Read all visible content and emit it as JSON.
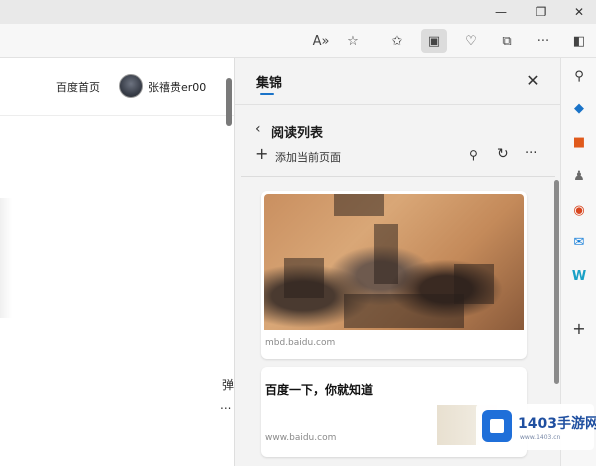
{
  "window": {
    "minimize_glyph": "—",
    "maximize_glyph": "❐",
    "close_glyph": "✕"
  },
  "toolbar": {
    "icons": [
      "read-aloud-icon",
      "favorite-star-icon",
      "favorites-icon",
      "collections-icon",
      "browser-essentials-icon",
      "screenshot-icon",
      "more-icon",
      "sidebar-toggle-icon"
    ],
    "read_aloud_glyph": "A»",
    "favorite_glyph": "☆",
    "favorites_glyph": "✩",
    "collections_glyph": "▣",
    "essentials_glyph": "♡",
    "screenshot_glyph": "⧉",
    "more_glyph": "···",
    "sidebar_glyph": "◧"
  },
  "page": {
    "nav_home": "百度首页",
    "username": "张禧贵er00",
    "snippet1": "弹",
    "snippet2": "..."
  },
  "collections": {
    "title": "集锦",
    "close_glyph": "✕",
    "back_glyph": "‹",
    "list_title": "阅读列表",
    "add_glyph": "+",
    "add_label": "添加当前页面",
    "search_glyph": "⚲",
    "refresh_glyph": "↻",
    "more_glyph": "···",
    "items": [
      {
        "domain": "mbd.baidu.com"
      },
      {
        "title": "百度一下，你就知道",
        "domain": "www.baidu.com"
      }
    ]
  },
  "sidebar": {
    "search_glyph": "⚲",
    "tag_glyph": "◆",
    "toolbox_glyph": "■",
    "games_glyph": "♟",
    "office_glyph": "◉",
    "outlook_glyph": "✉",
    "send_glyph": "W",
    "add_glyph": "+",
    "accent_colors": [
      "#1a73c8",
      "#e05a1c",
      "#0f7bd8"
    ]
  },
  "watermark": {
    "text": "1403手游网",
    "sub": "www.1403.cn"
  }
}
